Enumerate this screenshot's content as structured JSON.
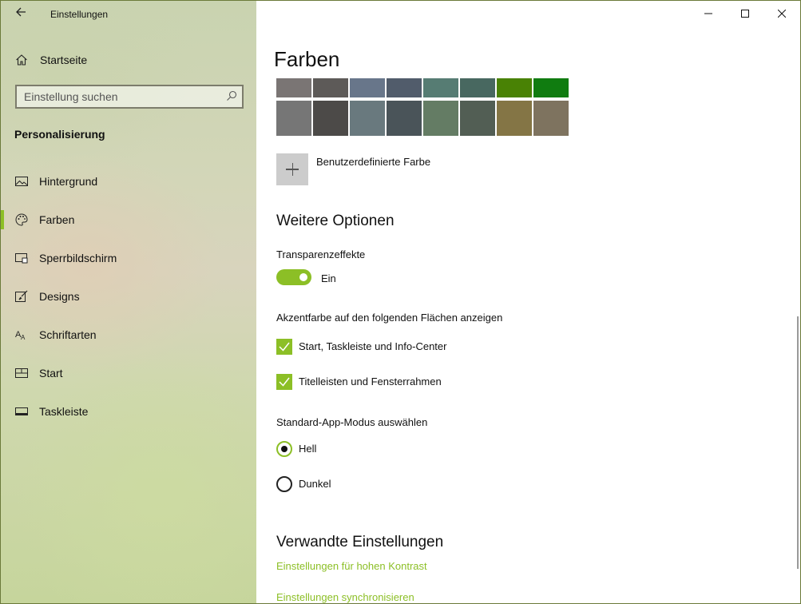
{
  "app": {
    "title": "Einstellungen"
  },
  "window_controls": {
    "minimize": "—",
    "maximize": "☐",
    "close": "✕"
  },
  "sidebar": {
    "home_label": "Startseite",
    "search_placeholder": "Einstellung suchen",
    "section": "Personalisierung",
    "items": [
      {
        "label": "Hintergrund",
        "icon": "picture-icon",
        "selected": false
      },
      {
        "label": "Farben",
        "icon": "palette-icon",
        "selected": true
      },
      {
        "label": "Sperrbildschirm",
        "icon": "lock-screen-icon",
        "selected": false
      },
      {
        "label": "Designs",
        "icon": "brush-icon",
        "selected": false
      },
      {
        "label": "Schriftarten",
        "icon": "font-icon",
        "selected": false
      },
      {
        "label": "Start",
        "icon": "start-menu-icon",
        "selected": false
      },
      {
        "label": "Taskleiste",
        "icon": "taskbar-icon",
        "selected": false
      }
    ]
  },
  "main": {
    "title": "Farben",
    "swatches_row1": [
      "#7a7574",
      "#5d5a58",
      "#68768a",
      "#515c6b",
      "#567c73",
      "#486860",
      "#498205",
      "#107c10"
    ],
    "swatches_row2": [
      "#767676",
      "#4c4a48",
      "#69797e",
      "#4a5459",
      "#647c64",
      "#525e54",
      "#847545",
      "#7e735f"
    ],
    "custom_color_label": "Benutzerdefinierte Farbe",
    "more_options_heading": "Weitere Optionen",
    "transparency_label": "Transparenzeffekte",
    "transparency_state": "Ein",
    "accent_surfaces_label": "Akzentfarbe auf den folgenden Flächen anzeigen",
    "checkbox_start": "Start, Taskleiste und Info-Center",
    "checkbox_titlebars": "Titelleisten und Fensterrahmen",
    "app_mode_label": "Standard-App-Modus auswählen",
    "mode_light": "Hell",
    "mode_dark": "Dunkel",
    "related_heading": "Verwandte Einstellungen",
    "link_contrast": "Einstellungen für hohen Kontrast",
    "link_sync": "Einstellungen synchronisieren"
  },
  "colors": {
    "accent": "#8cbf26"
  }
}
